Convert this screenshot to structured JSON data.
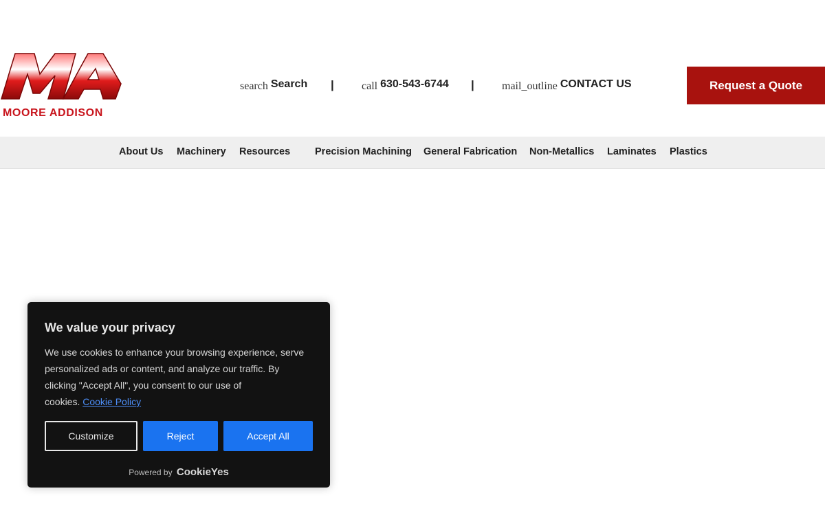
{
  "header": {
    "logo_text": "MOORE ADDISON",
    "search": {
      "icon": "search",
      "label": "Search"
    },
    "phone": {
      "icon": "call",
      "label": "630-543-6744"
    },
    "contact": {
      "icon": "mail_outline",
      "label": "CONTACT US"
    },
    "separator": "|",
    "quote_button": "Request a Quote",
    "brand_color": "#a8120e"
  },
  "nav": {
    "items": [
      {
        "label": "About Us"
      },
      {
        "label": "Machinery"
      },
      {
        "label": "Resources"
      },
      {
        "label": "Precision Machining"
      },
      {
        "label": "General Fabrication"
      },
      {
        "label": "Non-Metallics"
      },
      {
        "label": "Laminates"
      },
      {
        "label": "Plastics"
      }
    ]
  },
  "cookie_banner": {
    "title": "We value your privacy",
    "body": "We use cookies to enhance your browsing experience, serve personalized ads or content, and analyze our traffic. By clicking \"Accept All\", you consent to our use of cookies.",
    "body_line1": "We use cookies to enhance your browsing experience, serve",
    "body_line2": "personalized ads or content, and analyze our traffic. By",
    "body_line3": "clicking \"Accept All\", you consent to our use of",
    "body_line4": "cookies.",
    "policy_link": "Cookie Policy",
    "buttons": {
      "customize": "Customize",
      "reject": "Reject",
      "accept": "Accept All"
    },
    "powered_by": "Powered by",
    "powered_brand": "CookieYes",
    "accent_color": "#1a73f0"
  }
}
